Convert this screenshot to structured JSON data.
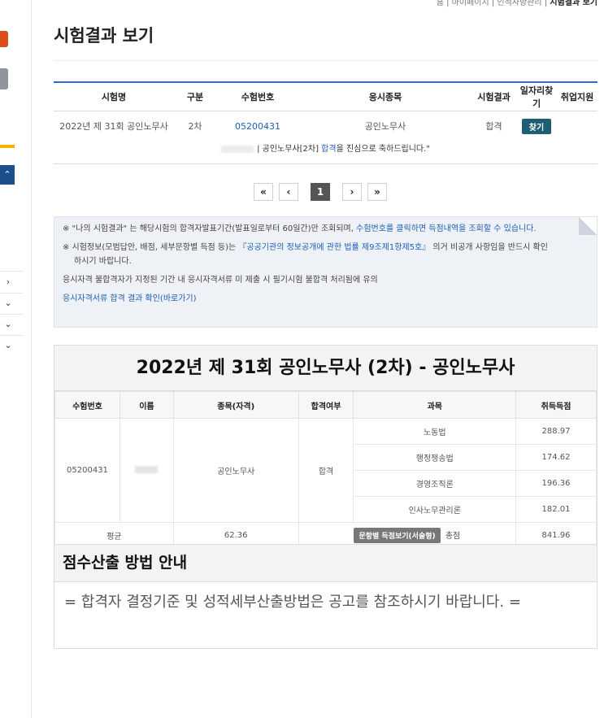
{
  "topnav": {
    "a": "홈",
    "b": "마이페이지",
    "c": "인적사항관리",
    "d": "시험결과 보기"
  },
  "page": {
    "title": "시험결과 보기"
  },
  "result_table": {
    "headers": [
      "시험명",
      "구분",
      "수험번호",
      "응시종목",
      "시험결과",
      "일자리찾기",
      "취업지원"
    ],
    "row": {
      "exam": "2022년 제 31회 공인노무사",
      "type": "2차",
      "number": "05200431",
      "field": "공인노무사",
      "result": "합격",
      "find_label": "찾기"
    },
    "congrats": {
      "pre": "| 공인노무사[2차] ",
      "pass": "합격",
      "post": "을 진심으로 축하드립니다.\""
    }
  },
  "pagination": {
    "first": "«",
    "prev": "‹",
    "current": "1",
    "next": "›",
    "last": "»"
  },
  "notice": {
    "line1_pre": "※ \"나의 시험결과\" 는 해당시험의 합격자발표기간(발표일로부터 60일간)만 조회되며, ",
    "line1_link": "수험번호를 클릭하면 득점내역을 조회할 수 있습니다.",
    "line2_pre": "※ 시험정보(모범답안, 배점, 세부문항별 득점 등)는 ",
    "line2_link": "『공공기관의 정보공개에 관한 법률 제9조제1항제5호』",
    "line2_post": " 의거 비공개 사항임을 반드시 확인",
    "line2_cont": "하시기 바랍니다.",
    "line3": "응시자격 불합격자가 지정된 기간 내 응시자격서류 미 제출 시 필기시험 불합격 처리됨에 유의",
    "line4_link": "응시자격서류 합격 결과 확인(바로가기)"
  },
  "score": {
    "title": "2022년 제 31회 공인노무사 (2차) - 공인노무사",
    "headers": [
      "수험번호",
      "이름",
      "종목(자격)",
      "합격여부",
      "과목",
      "취득득점"
    ],
    "number": "05200431",
    "qualification": "공인노무사",
    "pass": "합격",
    "subjects": [
      {
        "name": "노동법",
        "score": "288.97"
      },
      {
        "name": "행정쟁송법",
        "score": "174.62"
      },
      {
        "name": "경영조직론",
        "score": "196.36"
      },
      {
        "name": "인사노무관리론",
        "score": "182.01"
      }
    ],
    "avg_label": "평균",
    "avg_value": "62.36",
    "detail_button": "문항별 득점보기(서술형)",
    "total_label": "총점",
    "total_value": "841.96"
  },
  "method": {
    "title": "점수산출 방법 안내",
    "body": "= 합격자 결정기준 및 성적세부산출방법은 공고를 참조하시기 바랍니다. ="
  }
}
